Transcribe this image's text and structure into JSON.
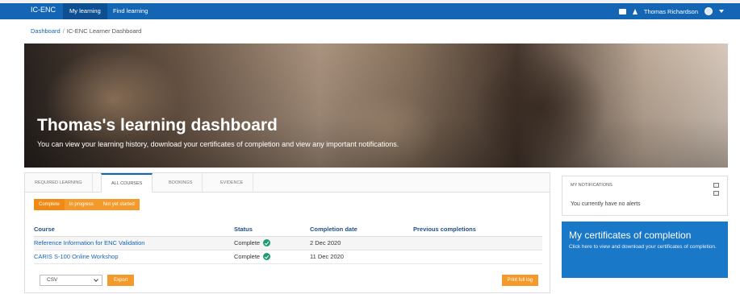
{
  "nav": {
    "brand": "IC-ENC",
    "tabs": [
      "My learning",
      "Find learning"
    ],
    "user_name": "Thomas Richardson"
  },
  "breadcrumb": {
    "home": "Dashboard",
    "separator": "/",
    "current": "IC-ENC Learner Dashboard"
  },
  "hero": {
    "title": "Thomas's learning dashboard",
    "subtitle": "You can view your learning history, download your certificates of completion and view any important notifications."
  },
  "tabs": [
    "REQUIRED LEARNING",
    "ALL COURSES",
    "BOOKINGS",
    "EVIDENCE"
  ],
  "filters": [
    "Complete",
    "In progress",
    "Not yet started"
  ],
  "table": {
    "headers": [
      "Course",
      "Status",
      "Completion date",
      "Previous completions"
    ],
    "rows": [
      {
        "course": "Reference Information for ENC Validation",
        "status": "Complete",
        "date": "2 Dec 2020",
        "previous": ""
      },
      {
        "course": "CARIS S-100 Online Workshop",
        "status": "Complete",
        "date": "11 Dec 2020",
        "previous": ""
      }
    ]
  },
  "export": {
    "format": "CSV",
    "export_label": "Export",
    "print_label": "Print full log"
  },
  "notifications": {
    "title": "MY NOTIFICATIONS",
    "message": "You currently have no alerts"
  },
  "certificates": {
    "title": "My certificates of completion",
    "text": "Click here to view and download your certificates of completion."
  },
  "colors": {
    "navbar": "#1466b5",
    "accent_orange": "#f39a2b",
    "cert_panel": "#1978c8",
    "status_check": "#1e9c6d"
  }
}
